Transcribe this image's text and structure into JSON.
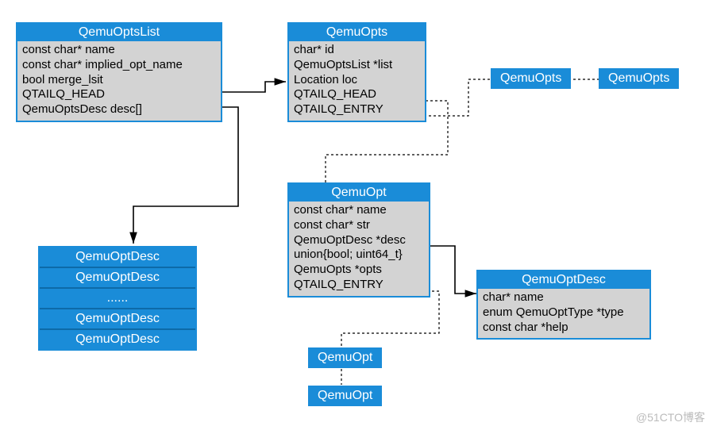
{
  "boxes": {
    "qemuOptsList": {
      "title": "QemuOptsList",
      "fields": [
        "const char* name",
        "const char* implied_opt_name",
        "bool merge_lsit",
        "QTAILQ_HEAD",
        "QemuOptsDesc desc[]"
      ]
    },
    "qemuOpts": {
      "title": "QemuOpts",
      "fields": [
        "char* id",
        "QemuOptsList *list",
        "Location loc",
        "QTAILQ_HEAD",
        "QTAILQ_ENTRY"
      ]
    },
    "qemuOpt": {
      "title": "QemuOpt",
      "fields": [
        "const char* name",
        "const char* str",
        "QemuOptDesc *desc",
        "union{bool; uint64_t}",
        "QemuOpts *opts",
        "QTAILQ_ENTRY"
      ]
    },
    "qemuOptDesc": {
      "title": "QemuOptDesc",
      "fields": [
        "char* name",
        "enum QemuOptType *type",
        "const char *help"
      ]
    }
  },
  "labels": {
    "qemuOpts1": "QemuOpts",
    "qemuOpts2": "QemuOpts",
    "qemuOpt1": "QemuOpt",
    "qemuOpt2": "QemuOpt"
  },
  "descList": [
    "QemuOptDesc",
    "QemuOptDesc",
    "......",
    "QemuOptDesc",
    "QemuOptDesc"
  ],
  "watermark": "@51CTO博客"
}
